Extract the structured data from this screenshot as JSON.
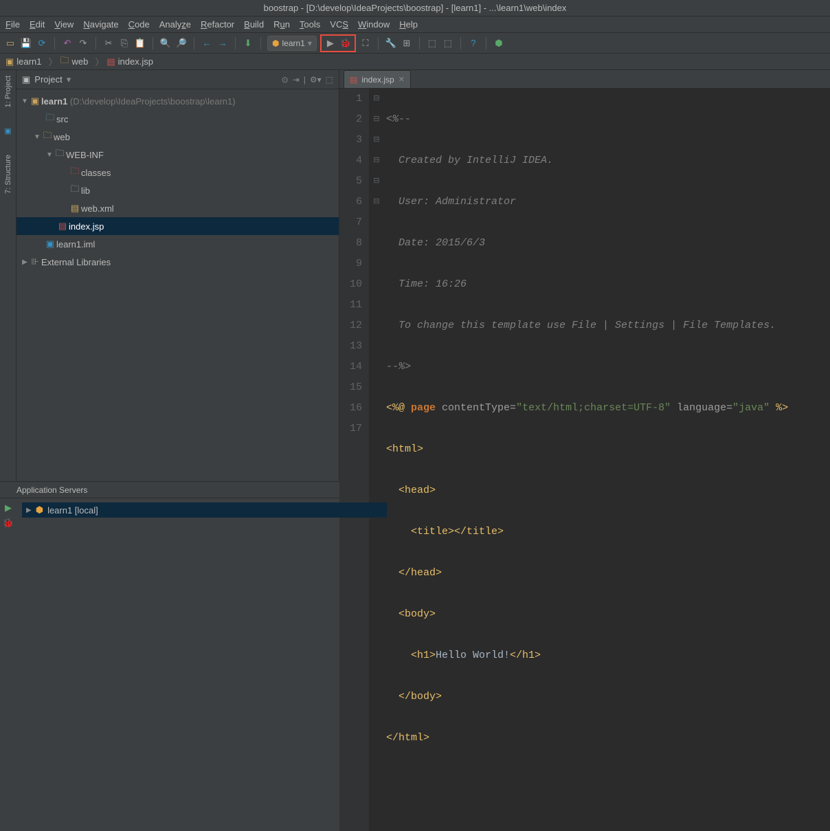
{
  "title": "boostrap - [D:\\develop\\IdeaProjects\\boostrap] - [learn1] - ...\\learn1\\web\\index",
  "menu": [
    "File",
    "Edit",
    "View",
    "Navigate",
    "Code",
    "Analyze",
    "Refactor",
    "Build",
    "Run",
    "Tools",
    "VCS",
    "Window",
    "Help"
  ],
  "run_config": "learn1",
  "breadcrumb": [
    {
      "icon": "folder",
      "label": "learn1"
    },
    {
      "icon": "folder",
      "label": "web"
    },
    {
      "icon": "jsp",
      "label": "index.jsp"
    }
  ],
  "sidebar_tabs": {
    "project": "1: Project",
    "structure": "7: Structure"
  },
  "project_panel": {
    "title": "Project"
  },
  "tree": {
    "root": {
      "label": "learn1",
      "path": " (D:\\develop\\IdeaProjects\\boostrap\\learn1)"
    },
    "src": "src",
    "web": "web",
    "webinf": "WEB-INF",
    "classes": "classes",
    "lib": "lib",
    "webxml": "web.xml",
    "indexjsp": "index.jsp",
    "iml": "learn1.iml",
    "extlib": "External Libraries"
  },
  "editor_tab": "index.jsp",
  "code": {
    "l1": "<%--",
    "l2": "  Created by IntelliJ IDEA.",
    "l3": "  User: Administrator",
    "l4": "  Date: 2015/6/3",
    "l5": "  Time: 16:26",
    "l6": "  To change this template use File | Settings | File Templates.",
    "l7": "--%>",
    "l8a": "<%@ ",
    "l8b": "page",
    "l8c": " contentType=",
    "l8d": "\"text/html;charset=UTF-8\"",
    "l8e": " language=",
    "l8f": "\"java\"",
    "l8g": " %>",
    "l9": "<html>",
    "l10": "  <head>",
    "l11a": "    <title>",
    "l11b": "</title>",
    "l12": "  </head>",
    "l13": "  <body>",
    "l14a": "    <h1>",
    "l14b": "Hello World!",
    "l14c": "</h1>",
    "l15": "  </body>",
    "l16": "</html>"
  },
  "bottom": {
    "header": "Application Servers",
    "server": "learn1 [local]"
  }
}
